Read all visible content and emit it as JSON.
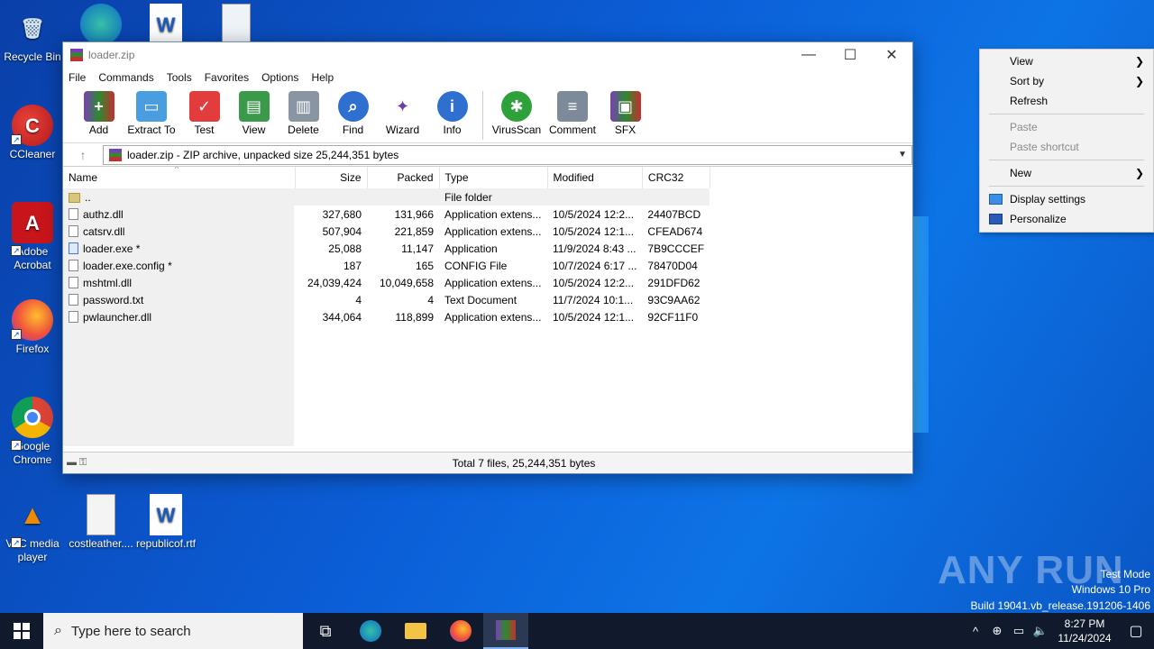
{
  "desktop": {
    "icons": [
      {
        "label": "Recycle Bin"
      },
      {
        "label": "CCleaner"
      },
      {
        "label": "Adobe Acrobat"
      },
      {
        "label": "Firefox"
      },
      {
        "label": "Google Chrome"
      },
      {
        "label": "VLC media player"
      },
      {
        "label": "costleather...."
      },
      {
        "label": "republicof.rtf"
      }
    ]
  },
  "window": {
    "title": "loader.zip",
    "menu": [
      "File",
      "Commands",
      "Tools",
      "Favorites",
      "Options",
      "Help"
    ],
    "toolbar": [
      "Add",
      "Extract To",
      "Test",
      "View",
      "Delete",
      "Find",
      "Wizard",
      "Info",
      "VirusScan",
      "Comment",
      "SFX"
    ],
    "path": "loader.zip - ZIP archive, unpacked size 25,244,351 bytes",
    "columns": [
      "Name",
      "Size",
      "Packed",
      "Type",
      "Modified",
      "CRC32"
    ],
    "files": [
      {
        "name": "..",
        "size": "",
        "packed": "",
        "type": "File folder",
        "modified": "",
        "crc": ""
      },
      {
        "name": "authz.dll",
        "size": "327,680",
        "packed": "131,966",
        "type": "Application extens...",
        "modified": "10/5/2024 12:2...",
        "crc": "24407BCD"
      },
      {
        "name": "catsrv.dll",
        "size": "507,904",
        "packed": "221,859",
        "type": "Application extens...",
        "modified": "10/5/2024 12:1...",
        "crc": "CFEAD674"
      },
      {
        "name": "loader.exe *",
        "size": "25,088",
        "packed": "11,147",
        "type": "Application",
        "modified": "11/9/2024 8:43 ...",
        "crc": "7B9CCCEF"
      },
      {
        "name": "loader.exe.config *",
        "size": "187",
        "packed": "165",
        "type": "CONFIG File",
        "modified": "10/7/2024 6:17 ...",
        "crc": "78470D04"
      },
      {
        "name": "mshtml.dll",
        "size": "24,039,424",
        "packed": "10,049,658",
        "type": "Application extens...",
        "modified": "10/5/2024 12:2...",
        "crc": "291DFD62"
      },
      {
        "name": "password.txt",
        "size": "4",
        "packed": "4",
        "type": "Text Document",
        "modified": "11/7/2024 10:1...",
        "crc": "93C9AA62"
      },
      {
        "name": "pwlauncher.dll",
        "size": "344,064",
        "packed": "118,899",
        "type": "Application extens...",
        "modified": "10/5/2024 12:1...",
        "crc": "92CF11F0"
      }
    ],
    "status": "Total 7 files, 25,244,351 bytes"
  },
  "context_menu": {
    "view": "View",
    "sort_by": "Sort by",
    "refresh": "Refresh",
    "paste": "Paste",
    "paste_shortcut": "Paste shortcut",
    "new": "New",
    "display_settings": "Display settings",
    "personalize": "Personalize"
  },
  "watermark": {
    "brand": "ANY RUN",
    "mode": "Test Mode",
    "edition": "Windows 10 Pro",
    "build": "Build 19041.vb_release.191206-1406"
  },
  "taskbar": {
    "search_placeholder": "Type here to search",
    "time": "8:27 PM",
    "date": "11/24/2024"
  }
}
